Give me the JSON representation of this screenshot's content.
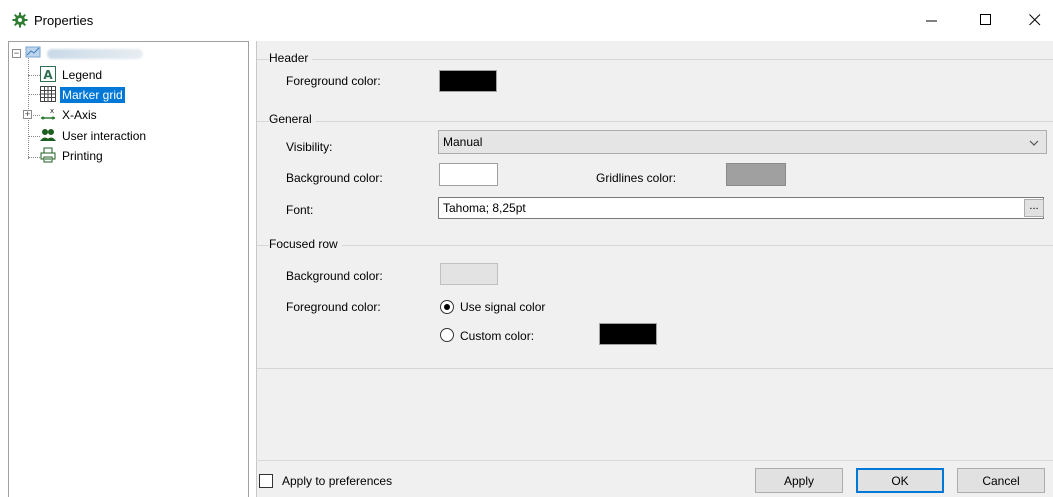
{
  "window": {
    "title": "Properties",
    "controls": {
      "minimize_icon": "minimize-icon",
      "maximize_icon": "maximize-icon",
      "close_icon": "close-icon"
    }
  },
  "tree": {
    "root_icon": "trend-graph-icon",
    "items": [
      {
        "label": "Legend",
        "icon": "legend-icon",
        "selected": false
      },
      {
        "label": "Marker grid",
        "icon": "grid-icon",
        "selected": true
      },
      {
        "label": "X-Axis",
        "icon": "axis-icon",
        "selected": false,
        "expandable": true
      },
      {
        "label": "User interaction",
        "icon": "users-icon",
        "selected": false
      },
      {
        "label": "Printing",
        "icon": "printer-icon",
        "selected": false
      }
    ]
  },
  "sections": {
    "header": {
      "title": "Header",
      "foreground_label": "Foreground color:",
      "foreground_color": "#000000"
    },
    "general": {
      "title": "General",
      "visibility_label": "Visibility:",
      "visibility_value": "Manual",
      "background_label": "Background color:",
      "background_color": "#ffffff",
      "gridlines_label": "Gridlines color:",
      "gridlines_color": "#a0a0a0",
      "font_label": "Font:",
      "font_value": "Tahoma; 8,25pt",
      "font_button": "..."
    },
    "focused_row": {
      "title": "Focused row",
      "background_label": "Background color:",
      "background_color": "#e3e3e3",
      "foreground_label": "Foreground color:",
      "option_signal": "Use signal color",
      "option_custom": "Custom color:",
      "selected_option": "Use signal color",
      "custom_color": "#000000"
    }
  },
  "footer": {
    "apply_prefs_label": "Apply to preferences",
    "apply_prefs_checked": false,
    "apply_button": "Apply",
    "ok_button": "OK",
    "cancel_button": "Cancel"
  },
  "colors": {
    "accent": "#0078d7",
    "title_icon": "#2e7d32"
  }
}
